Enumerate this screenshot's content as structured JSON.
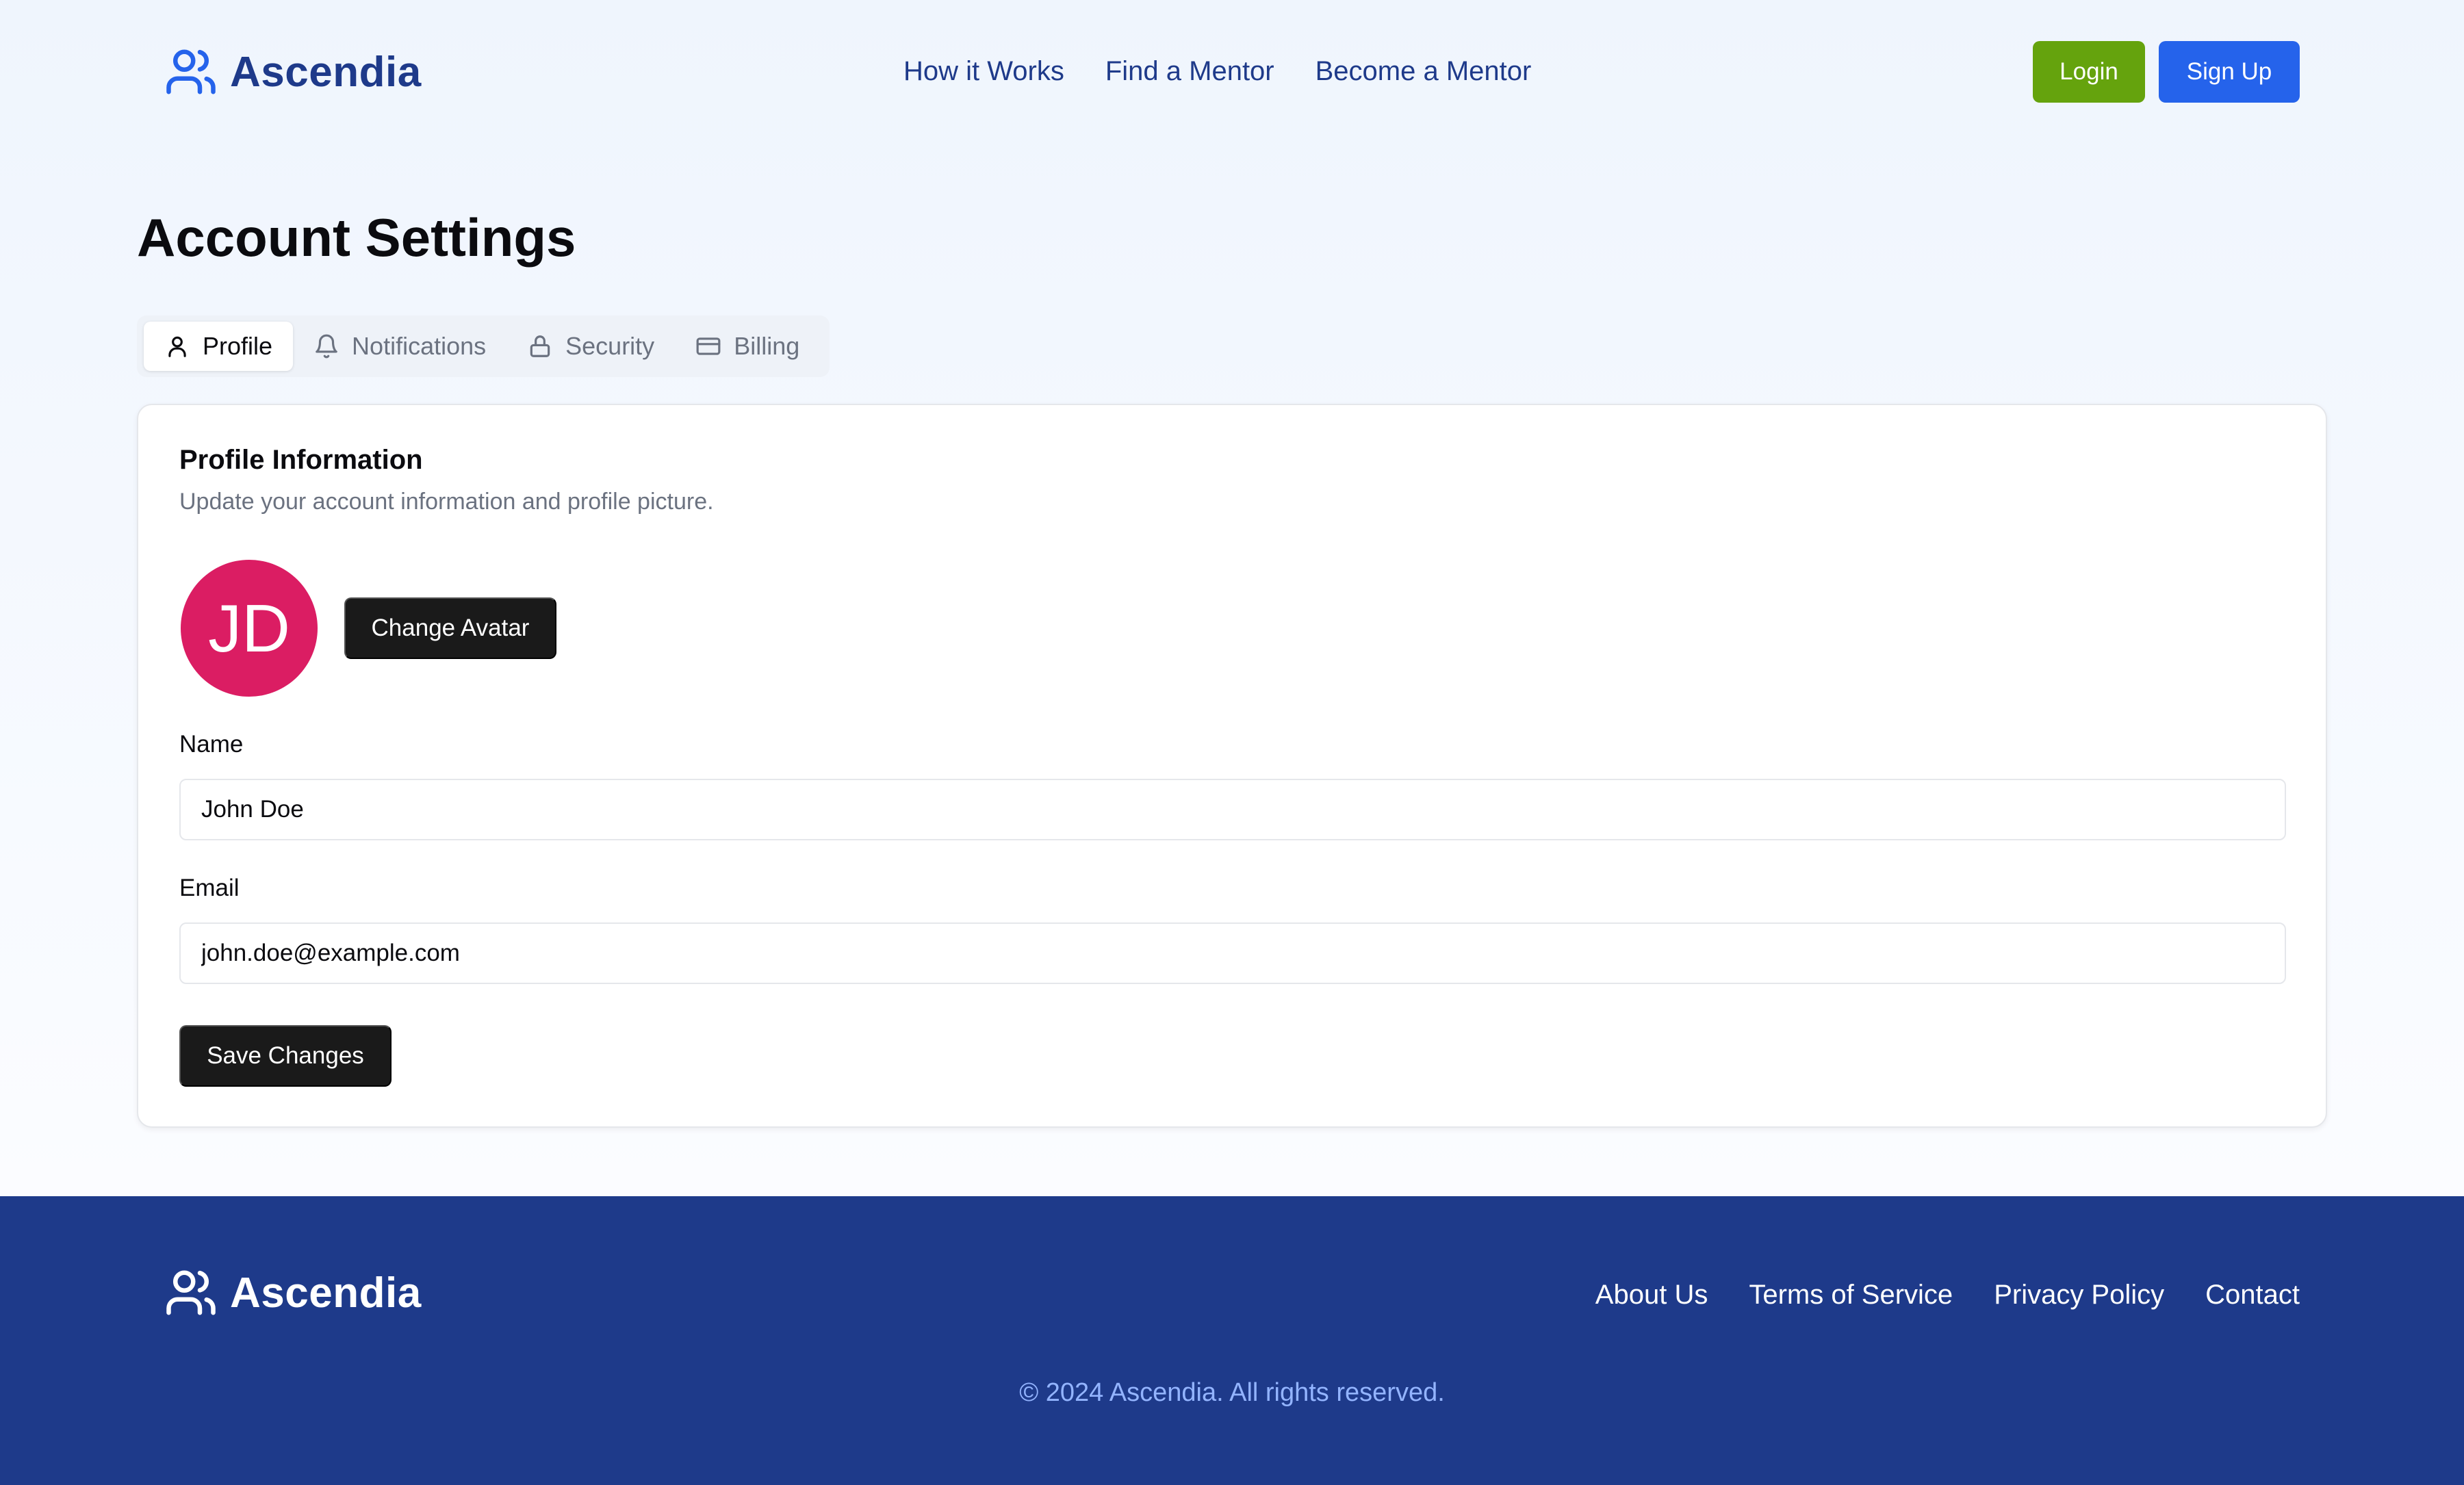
{
  "colors": {
    "brand": "#1e3a8a",
    "brand_icon": "#2563eb",
    "login": "#65a30d",
    "signup": "#2563eb",
    "avatar_bg": "#db1d63",
    "dark_button": "#1a1a1a",
    "footer_bg": "#1e3a8a"
  },
  "header": {
    "logo_icon": "users-icon",
    "brand_name": "Ascendia",
    "nav": [
      {
        "label": "How it Works"
      },
      {
        "label": "Find a Mentor"
      },
      {
        "label": "Become a Mentor"
      }
    ],
    "login_label": "Login",
    "signup_label": "Sign Up"
  },
  "main": {
    "title": "Account Settings",
    "tabs": [
      {
        "label": "Profile",
        "icon": "user-icon",
        "active": true
      },
      {
        "label": "Notifications",
        "icon": "bell-icon",
        "active": false
      },
      {
        "label": "Security",
        "icon": "lock-icon",
        "active": false
      },
      {
        "label": "Billing",
        "icon": "credit-card-icon",
        "active": false
      }
    ],
    "card": {
      "title": "Profile Information",
      "subtitle": "Update your account information and profile picture.",
      "avatar_initials": "JD",
      "change_avatar_label": "Change Avatar",
      "name_label": "Name",
      "name_value": "John Doe",
      "email_label": "Email",
      "email_value": "john.doe@example.com",
      "save_label": "Save Changes"
    }
  },
  "footer": {
    "logo_icon": "users-icon",
    "brand_name": "Ascendia",
    "links": [
      {
        "label": "About Us"
      },
      {
        "label": "Terms of Service"
      },
      {
        "label": "Privacy Policy"
      },
      {
        "label": "Contact"
      }
    ],
    "copyright": "© 2024 Ascendia. All rights reserved."
  }
}
